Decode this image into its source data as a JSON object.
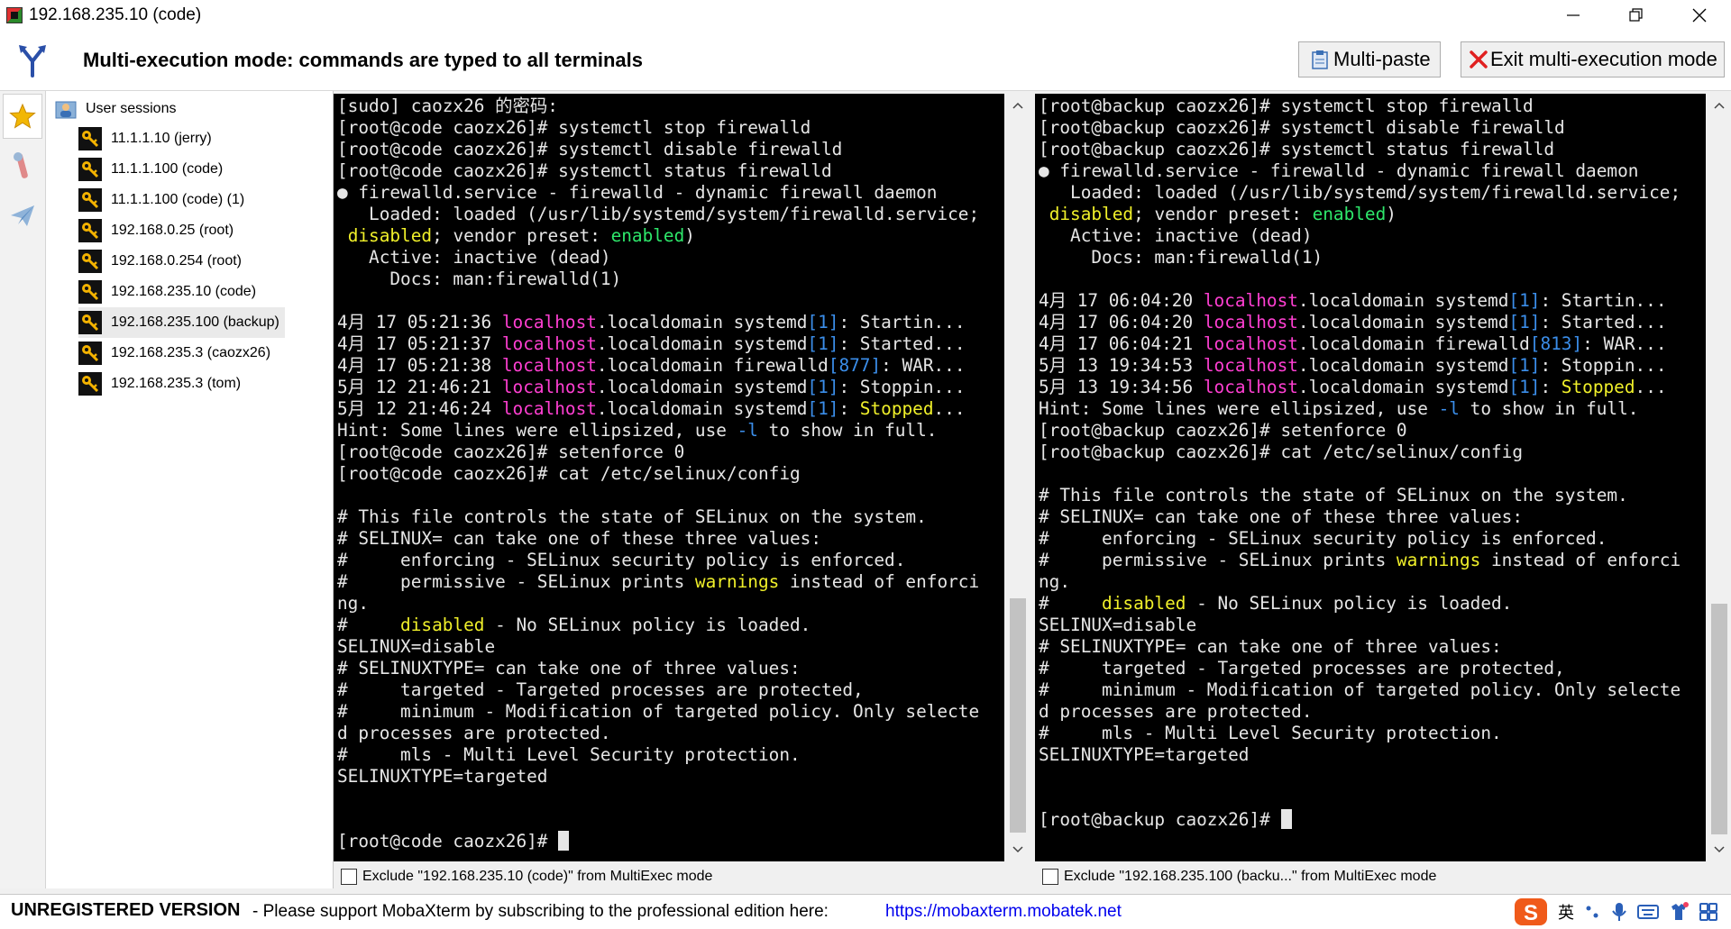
{
  "window": {
    "title": "192.168.235.10 (code)"
  },
  "multiexec": {
    "banner": "Multi-execution mode: commands are typed to all terminals",
    "multipaste_label": "Multi-paste",
    "exit_label": "Exit multi-execution mode"
  },
  "sessions": {
    "root_label": "User sessions",
    "items": [
      "11.1.1.10 (jerry)",
      "11.1.1.100 (code)",
      "11.1.1.100 (code) (1)",
      "192.168.0.25 (root)",
      "192.168.0.254 (root)",
      "192.168.235.10 (code)",
      "192.168.235.100 (backup)",
      "192.168.235.3 (caozx26)",
      "192.168.235.3 (tom)"
    ],
    "selected_index": 6
  },
  "terminals": [
    {
      "exclude_label": "Exclude \"192.168.235.10 (code)\" from MultiExec mode",
      "lines": [
        [
          [
            "[sudo] caozx26 的密码:"
          ]
        ],
        [
          [
            "[root@code caozx26]# systemctl stop firewalld"
          ]
        ],
        [
          [
            "[root@code caozx26]# systemctl disable firewalld"
          ]
        ],
        [
          [
            "[root@code caozx26]# systemctl status firewalld"
          ]
        ],
        [
          [
            "● firewalld.service - firewalld - dynamic firewall daemon"
          ]
        ],
        [
          [
            "   Loaded: loaded (/usr/lib/systemd/system/firewalld.service;"
          ]
        ],
        [
          [
            " "
          ],
          [
            "disabled",
            "yellow"
          ],
          [
            "; vendor preset: "
          ],
          [
            "enabled",
            "green"
          ],
          [
            ")"
          ]
        ],
        [
          [
            "   Active: inactive (dead)"
          ]
        ],
        [
          [
            "     Docs: man:firewalld(1)"
          ]
        ],
        [
          [
            ""
          ]
        ],
        [
          [
            "4月 17 05:21:36 "
          ],
          [
            "localhost",
            "pink"
          ],
          [
            ".localdomain systemd"
          ],
          [
            "[1]",
            "blue"
          ],
          [
            ": Startin..."
          ]
        ],
        [
          [
            "4月 17 05:21:37 "
          ],
          [
            "localhost",
            "pink"
          ],
          [
            ".localdomain systemd"
          ],
          [
            "[1]",
            "blue"
          ],
          [
            ": Started..."
          ]
        ],
        [
          [
            "4月 17 05:21:38 "
          ],
          [
            "localhost",
            "pink"
          ],
          [
            ".localdomain firewalld"
          ],
          [
            "[877]",
            "blue"
          ],
          [
            ": WAR..."
          ]
        ],
        [
          [
            "5月 12 21:46:21 "
          ],
          [
            "localhost",
            "pink"
          ],
          [
            ".localdomain systemd"
          ],
          [
            "[1]",
            "blue"
          ],
          [
            ": Stoppin..."
          ]
        ],
        [
          [
            "5月 12 21:46:24 "
          ],
          [
            "localhost",
            "pink"
          ],
          [
            ".localdomain systemd"
          ],
          [
            "[1]",
            "blue"
          ],
          [
            ": "
          ],
          [
            "Stopped",
            "yellow"
          ],
          [
            "..."
          ]
        ],
        [
          [
            "Hint: Some lines were ellipsized, use "
          ],
          [
            "-l",
            "blue"
          ],
          [
            " to show in full."
          ]
        ],
        [
          [
            "[root@code caozx26]# setenforce 0"
          ]
        ],
        [
          [
            "[root@code caozx26]# cat /etc/selinux/config"
          ]
        ],
        [
          [
            ""
          ]
        ],
        [
          [
            "# This file controls the state of SELinux on the system."
          ]
        ],
        [
          [
            "# SELINUX= can take one of these three values:"
          ]
        ],
        [
          [
            "#     enforcing - SELinux security policy is enforced."
          ]
        ],
        [
          [
            "#     permissive - SELinux prints "
          ],
          [
            "warnings",
            "yellow"
          ],
          [
            " instead of enforci"
          ]
        ],
        [
          [
            "ng."
          ]
        ],
        [
          [
            "#     "
          ],
          [
            "disabled",
            "yellow"
          ],
          [
            " - No SELinux policy is loaded."
          ]
        ],
        [
          [
            "SELINUX=disable"
          ]
        ],
        [
          [
            "# SELINUXTYPE= can take one of three values:"
          ]
        ],
        [
          [
            "#     targeted - Targeted processes are protected,"
          ]
        ],
        [
          [
            "#     minimum - Modification of targeted policy. Only selecte"
          ]
        ],
        [
          [
            "d processes are protected."
          ]
        ],
        [
          [
            "#     mls - Multi Level Security protection."
          ]
        ],
        [
          [
            "SELINUXTYPE=targeted"
          ]
        ],
        [
          [
            ""
          ]
        ],
        [
          [
            ""
          ]
        ],
        [
          [
            "[root@code caozx26]# "
          ]
        ]
      ]
    },
    {
      "exclude_label": "Exclude \"192.168.235.100 (backu...\" from MultiExec mode",
      "lines": [
        [
          [
            "[root@backup caozx26]# systemctl stop firewalld"
          ]
        ],
        [
          [
            "[root@backup caozx26]# systemctl disable firewalld"
          ]
        ],
        [
          [
            "[root@backup caozx26]# systemctl status firewalld"
          ]
        ],
        [
          [
            "● firewalld.service - firewalld - dynamic firewall daemon"
          ]
        ],
        [
          [
            "   Loaded: loaded (/usr/lib/systemd/system/firewalld.service;"
          ]
        ],
        [
          [
            " "
          ],
          [
            "disabled",
            "yellow"
          ],
          [
            "; vendor preset: "
          ],
          [
            "enabled",
            "green"
          ],
          [
            ")"
          ]
        ],
        [
          [
            "   Active: inactive (dead)"
          ]
        ],
        [
          [
            "     Docs: man:firewalld(1)"
          ]
        ],
        [
          [
            ""
          ]
        ],
        [
          [
            "4月 17 06:04:20 "
          ],
          [
            "localhost",
            "pink"
          ],
          [
            ".localdomain systemd"
          ],
          [
            "[1]",
            "blue"
          ],
          [
            ": Startin..."
          ]
        ],
        [
          [
            "4月 17 06:04:20 "
          ],
          [
            "localhost",
            "pink"
          ],
          [
            ".localdomain systemd"
          ],
          [
            "[1]",
            "blue"
          ],
          [
            ": Started..."
          ]
        ],
        [
          [
            "4月 17 06:04:21 "
          ],
          [
            "localhost",
            "pink"
          ],
          [
            ".localdomain firewalld"
          ],
          [
            "[813]",
            "blue"
          ],
          [
            ": WAR..."
          ]
        ],
        [
          [
            "5月 13 19:34:53 "
          ],
          [
            "localhost",
            "pink"
          ],
          [
            ".localdomain systemd"
          ],
          [
            "[1]",
            "blue"
          ],
          [
            ": Stoppin..."
          ]
        ],
        [
          [
            "5月 13 19:34:56 "
          ],
          [
            "localhost",
            "pink"
          ],
          [
            ".localdomain systemd"
          ],
          [
            "[1]",
            "blue"
          ],
          [
            ": "
          ],
          [
            "Stopped",
            "yellow"
          ],
          [
            "..."
          ]
        ],
        [
          [
            "Hint: Some lines were ellipsized, use "
          ],
          [
            "-l",
            "blue"
          ],
          [
            " to show in full."
          ]
        ],
        [
          [
            "[root@backup caozx26]# setenforce 0"
          ]
        ],
        [
          [
            "[root@backup caozx26]# cat /etc/selinux/config"
          ]
        ],
        [
          [
            ""
          ]
        ],
        [
          [
            "# This file controls the state of SELinux on the system."
          ]
        ],
        [
          [
            "# SELINUX= can take one of these three values:"
          ]
        ],
        [
          [
            "#     enforcing - SELinux security policy is enforced."
          ]
        ],
        [
          [
            "#     permissive - SELinux prints "
          ],
          [
            "warnings",
            "yellow"
          ],
          [
            " instead of enforci"
          ]
        ],
        [
          [
            "ng."
          ]
        ],
        [
          [
            "#     "
          ],
          [
            "disabled",
            "yellow"
          ],
          [
            " - No SELinux policy is loaded."
          ]
        ],
        [
          [
            "SELINUX=disable"
          ]
        ],
        [
          [
            "# SELINUXTYPE= can take one of three values:"
          ]
        ],
        [
          [
            "#     targeted - Targeted processes are protected,"
          ]
        ],
        [
          [
            "#     minimum - Modification of targeted policy. Only selecte"
          ]
        ],
        [
          [
            "d processes are protected."
          ]
        ],
        [
          [
            "#     mls - Multi Level Security protection."
          ]
        ],
        [
          [
            "SELINUXTYPE=targeted"
          ]
        ],
        [
          [
            ""
          ]
        ],
        [
          [
            ""
          ]
        ],
        [
          [
            "[root@backup caozx26]# "
          ]
        ]
      ]
    }
  ],
  "statusbar": {
    "registration": "UNREGISTERED VERSION",
    "message": "-  Please support MobaXterm by subscribing to the professional edition here:",
    "link": "https://mobaxterm.mobatek.net",
    "ime_label": "英"
  },
  "colors": {
    "pink": "#ff3fd2",
    "blue": "#3b8eea",
    "green": "#2ee86b",
    "yellow": "#f0f02a",
    "terminal_bg": "#000000",
    "terminal_fg": "#e6e6e6",
    "link": "#0000ee"
  },
  "icons": {
    "favorites": "star-icon",
    "tools": "tools-icon",
    "sftp": "paper-plane-icon",
    "session": "key-icon",
    "multipaste": "clipboard-icon",
    "exit": "red-x-icon"
  }
}
